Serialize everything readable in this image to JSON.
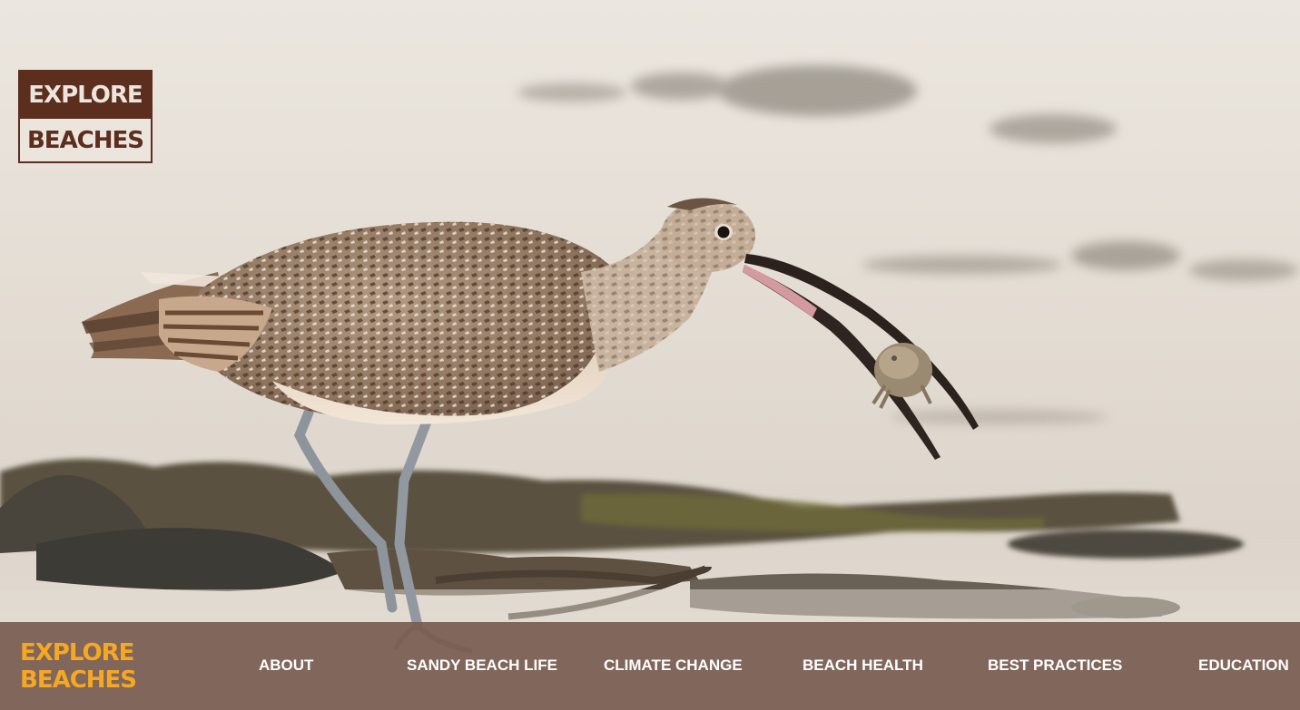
{
  "photo": {
    "icon": "curlew-photo",
    "colors": {
      "sand_light": "#ede8e1",
      "sand_mid": "#d9d1c6",
      "bird_body": "#a58a72",
      "bird_belly": "#ecdccb",
      "bill": "#2e2420",
      "legs": "#8f959c",
      "seaweed": "#4a4536"
    }
  },
  "badge": {
    "line1": "EXPLORE",
    "line2": "BEACHES",
    "colors": {
      "dark": "#5b2e1d",
      "light": "#ece5dd"
    }
  },
  "nav": {
    "background": "#785c52",
    "logo": {
      "line1": "EXPLORE",
      "line2": "BEACHES",
      "color": "#f7a823"
    },
    "items": [
      {
        "label": "ABOUT"
      },
      {
        "label": "SANDY BEACH LIFE"
      },
      {
        "label": "CLIMATE CHANGE"
      },
      {
        "label": "BEACH HEALTH"
      },
      {
        "label": "BEST PRACTICES"
      },
      {
        "label": "EDUCATION"
      }
    ]
  }
}
